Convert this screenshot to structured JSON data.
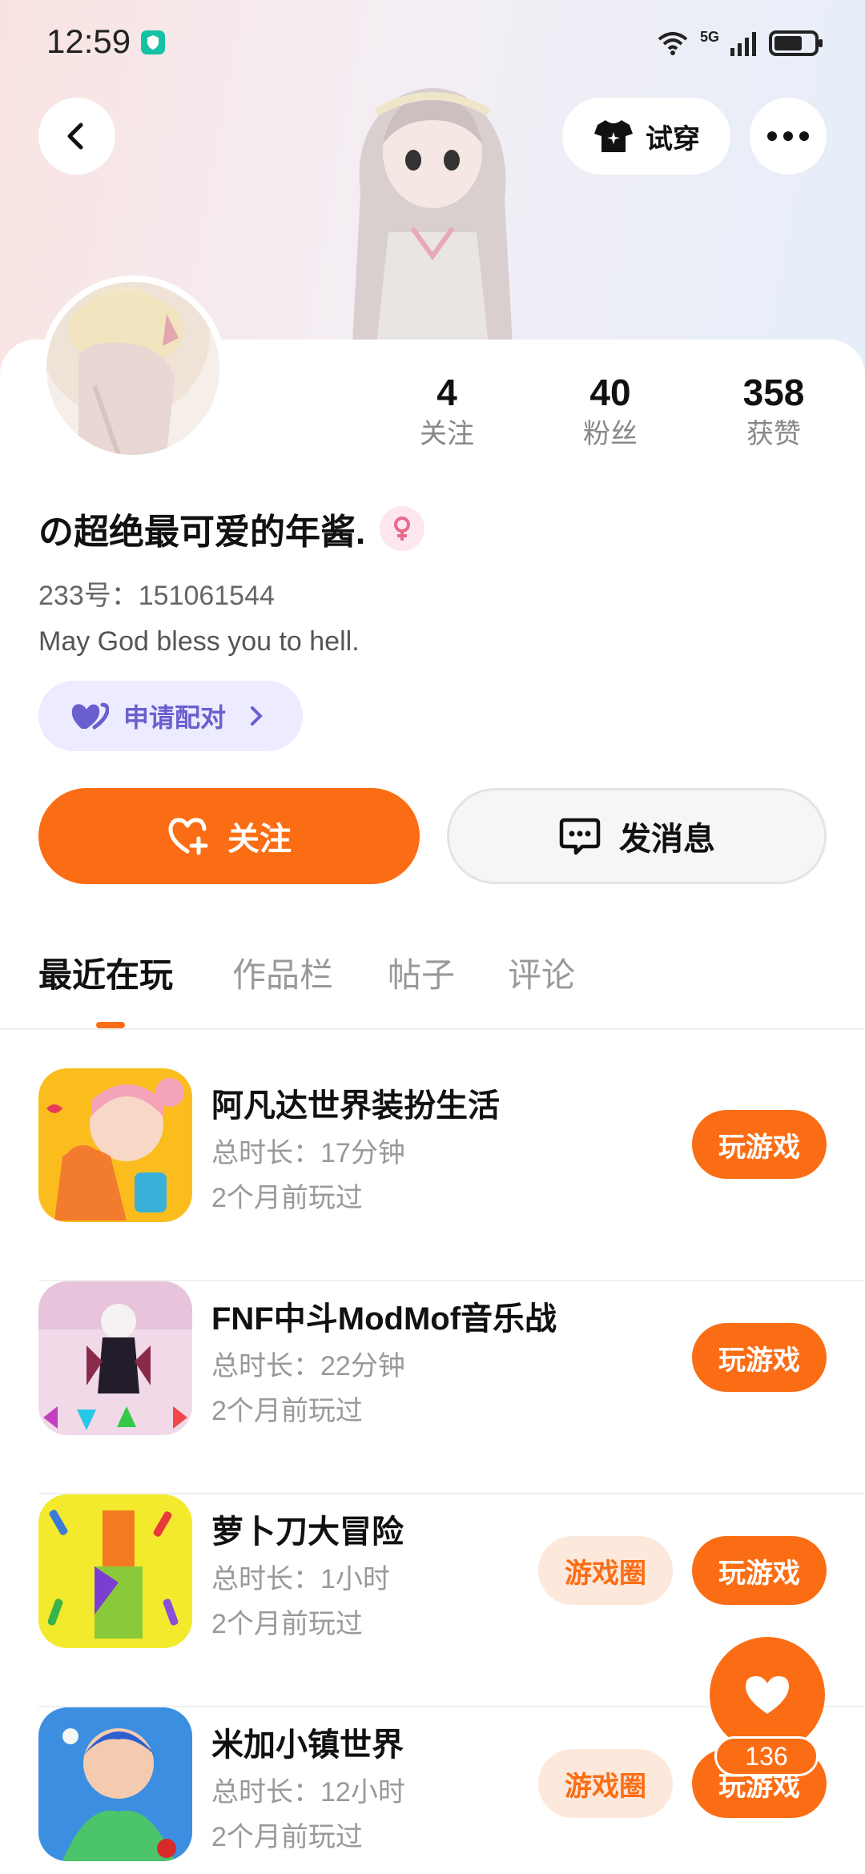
{
  "status_bar": {
    "time": "12:59",
    "network": "5G",
    "icons": [
      "shield-icon",
      "wifi-icon",
      "signal-icon",
      "battery-icon"
    ]
  },
  "header": {
    "try_on_label": "试穿"
  },
  "profile": {
    "stats": [
      {
        "value": "4",
        "label": "关注"
      },
      {
        "value": "40",
        "label": "粉丝"
      },
      {
        "value": "358",
        "label": "获赞"
      }
    ],
    "username": "の超绝最可爱的年酱.",
    "uid": "233号：151061544",
    "bio": "May God bless you to hell.",
    "pair_label": "申请配对"
  },
  "actions": {
    "follow_label": "关注",
    "message_label": "发消息"
  },
  "tabs": [
    "最近在玩",
    "作品栏",
    "帖子",
    "评论"
  ],
  "games": [
    {
      "title": "阿凡达世界装扮生活",
      "duration": "总时长：17分钟",
      "last_played": "2个月前玩过",
      "play_label": "玩游戏",
      "circle_label": ""
    },
    {
      "title": "FNF中斗ModMof音乐战",
      "duration": "总时长：22分钟",
      "last_played": "2个月前玩过",
      "play_label": "玩游戏",
      "circle_label": ""
    },
    {
      "title": "萝卜刀大冒险",
      "duration": "总时长：1小时",
      "last_played": "2个月前玩过",
      "play_label": "玩游戏",
      "circle_label": "游戏圈"
    },
    {
      "title": "米加小镇世界",
      "duration": "总时长：12小时",
      "last_played": "2个月前玩过",
      "play_label": "玩游戏",
      "circle_label": "游戏圈"
    }
  ],
  "fab": {
    "like_count": "136"
  },
  "colors": {
    "accent": "#fb6d14",
    "pair": "#6a5fcf"
  }
}
